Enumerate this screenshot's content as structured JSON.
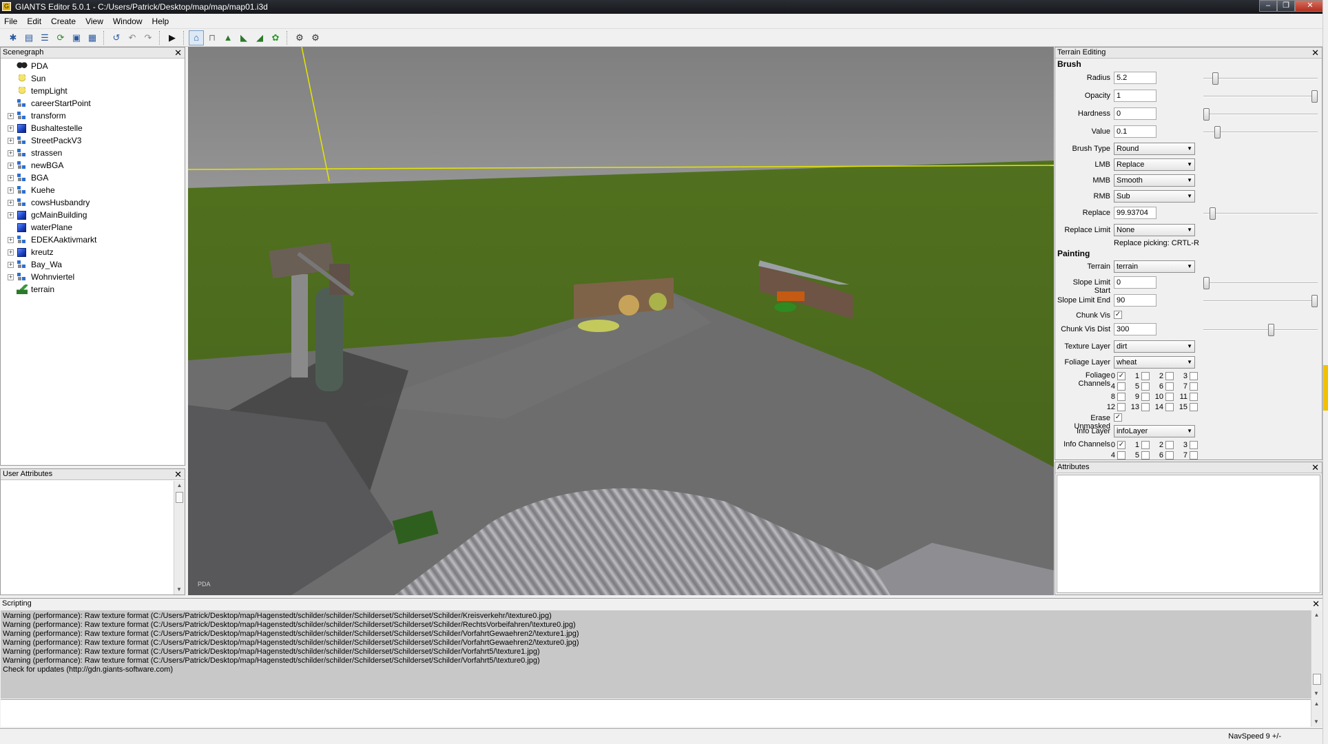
{
  "window": {
    "title": "GIANTS Editor 5.0.1 - C:/Users/Patrick/Desktop/map/map/map01.i3d",
    "controls": [
      "–",
      "❐",
      "✕"
    ]
  },
  "menu": [
    "File",
    "Edit",
    "Create",
    "View",
    "Window",
    "Help"
  ],
  "scenegraph": {
    "title": "Scenegraph",
    "close": "✕",
    "items": [
      {
        "label": "PDA",
        "icon": "pda-icon",
        "expandable": false
      },
      {
        "label": "Sun",
        "icon": "light-icon",
        "expandable": false
      },
      {
        "label": "tempLight",
        "icon": "light-icon",
        "expandable": false
      },
      {
        "label": "careerStartPoint",
        "icon": "transformgroup-icon",
        "expandable": false
      },
      {
        "label": "transform",
        "icon": "transformgroup-icon",
        "expandable": true
      },
      {
        "label": "Bushaltestelle",
        "icon": "shape-icon",
        "expandable": true
      },
      {
        "label": "StreetPackV3",
        "icon": "transformgroup-icon",
        "expandable": true
      },
      {
        "label": "strassen",
        "icon": "transformgroup-icon",
        "expandable": true
      },
      {
        "label": "newBGA",
        "icon": "transformgroup-icon",
        "expandable": true
      },
      {
        "label": "BGA",
        "icon": "transformgroup-icon",
        "expandable": true
      },
      {
        "label": "Kuehe",
        "icon": "transformgroup-icon",
        "expandable": true
      },
      {
        "label": "cowsHusbandry",
        "icon": "transformgroup-icon",
        "expandable": true
      },
      {
        "label": "gcMainBuilding",
        "icon": "shape-icon",
        "expandable": true
      },
      {
        "label": "waterPlane",
        "icon": "shape-icon",
        "expandable": false
      },
      {
        "label": "EDEKAaktivmarkt",
        "icon": "transformgroup-icon",
        "expandable": true
      },
      {
        "label": "kreutz",
        "icon": "shape-icon",
        "expandable": true
      },
      {
        "label": "Bay_Wa",
        "icon": "transformgroup-icon",
        "expandable": true
      },
      {
        "label": "Wohnviertel",
        "icon": "transformgroup-icon",
        "expandable": true
      },
      {
        "label": "terrain",
        "icon": "terrain-icon",
        "expandable": false
      }
    ]
  },
  "user_attributes": {
    "title": "User Attributes",
    "close": "✕"
  },
  "viewport": {
    "camera_label": "PDA"
  },
  "terrain_editing": {
    "title": "Terrain Editing",
    "close": "✕",
    "brush_heading": "Brush",
    "radius": {
      "label": "Radius",
      "value": "5.2",
      "slider": 0.08
    },
    "opacity": {
      "label": "Opacity",
      "value": "1",
      "slider": 1.0
    },
    "hardness": {
      "label": "Hardness",
      "value": "0",
      "slider": 0.0
    },
    "value": {
      "label": "Value",
      "value": "0.1",
      "slider": 0.1
    },
    "brush_type": {
      "label": "Brush Type",
      "value": "Round"
    },
    "lmb": {
      "label": "LMB",
      "value": "Replace"
    },
    "mmb": {
      "label": "MMB",
      "value": "Smooth"
    },
    "rmb": {
      "label": "RMB",
      "value": "Sub"
    },
    "replace": {
      "label": "Replace",
      "value": "99.93704",
      "slider": 0.06
    },
    "replace_limit": {
      "label": "Replace Limit",
      "value": "None"
    },
    "replace_picking": "Replace picking: CRTL-R",
    "painting_heading": "Painting",
    "terrain": {
      "label": "Terrain",
      "value": "terrain"
    },
    "slope_start": {
      "label": "Slope Limit Start",
      "value": "0",
      "slider": 0.0
    },
    "slope_end": {
      "label": "Slope Limit End",
      "value": "90",
      "slider": 1.0
    },
    "chunk_vis": {
      "label": "Chunk Vis",
      "checked": true
    },
    "chunk_vis_dist": {
      "label": "Chunk Vis Dist",
      "value": "300",
      "slider": 0.6
    },
    "texture_layer": {
      "label": "Texture Layer",
      "value": "dirt"
    },
    "foliage_layer": {
      "label": "Foliage Layer",
      "value": "wheat"
    },
    "foliage_channels": {
      "label": "Foliage Channels",
      "checked": [
        0
      ]
    },
    "erase_unmasked": {
      "label": "Erase Unmasked",
      "checked": true
    },
    "info_layer": {
      "label": "Info Layer",
      "value": "infoLayer"
    },
    "info_channels": {
      "label": "Info Channels",
      "checked": [
        0
      ]
    },
    "channel_numbers": [
      "0",
      "1",
      "2",
      "3",
      "4",
      "5",
      "6",
      "7",
      "8",
      "9",
      "10",
      "11",
      "12",
      "13",
      "14",
      "15"
    ]
  },
  "attributes": {
    "title": "Attributes",
    "close": "✕"
  },
  "scripting": {
    "title": "Scripting",
    "close": "✕",
    "lines": [
      "Warning (performance): Raw texture format (C:/Users/Patrick/Desktop/map/Hagenstedt/schilder/schilder/Schilderset/Schilderset/Schilder/Kreisverkehr/\\texture0.jpg)",
      "Warning (performance): Raw texture format (C:/Users/Patrick/Desktop/map/Hagenstedt/schilder/schilder/Schilderset/Schilderset/Schilder/RechtsVorbeifahren/\\texture0.jpg)",
      "Warning (performance): Raw texture format (C:/Users/Patrick/Desktop/map/Hagenstedt/schilder/schilder/Schilderset/Schilderset/Schilder/VorfahrtGewaehren2/\\texture1.jpg)",
      "Warning (performance): Raw texture format (C:/Users/Patrick/Desktop/map/Hagenstedt/schilder/schilder/Schilderset/Schilderset/Schilder/VorfahrtGewaehren2/\\texture0.jpg)",
      "Warning (performance): Raw texture format (C:/Users/Patrick/Desktop/map/Hagenstedt/schilder/schilder/Schilderset/Schilderset/Schilder/Vorfahrt5/\\texture1.jpg)",
      "Warning (performance): Raw texture format (C:/Users/Patrick/Desktop/map/Hagenstedt/schilder/schilder/Schilderset/Schilderset/Schilder/Vorfahrt5/\\texture0.jpg)",
      "Check for updates (http://gdn.giants-software.com)"
    ]
  },
  "status": {
    "navspeed": "NavSpeed 9 +/-"
  },
  "colors": {
    "grass": "#4f6a1e",
    "gravel": "#6e6e6e",
    "sky": "#8e8e8e",
    "gizmo": "#e6e600"
  }
}
